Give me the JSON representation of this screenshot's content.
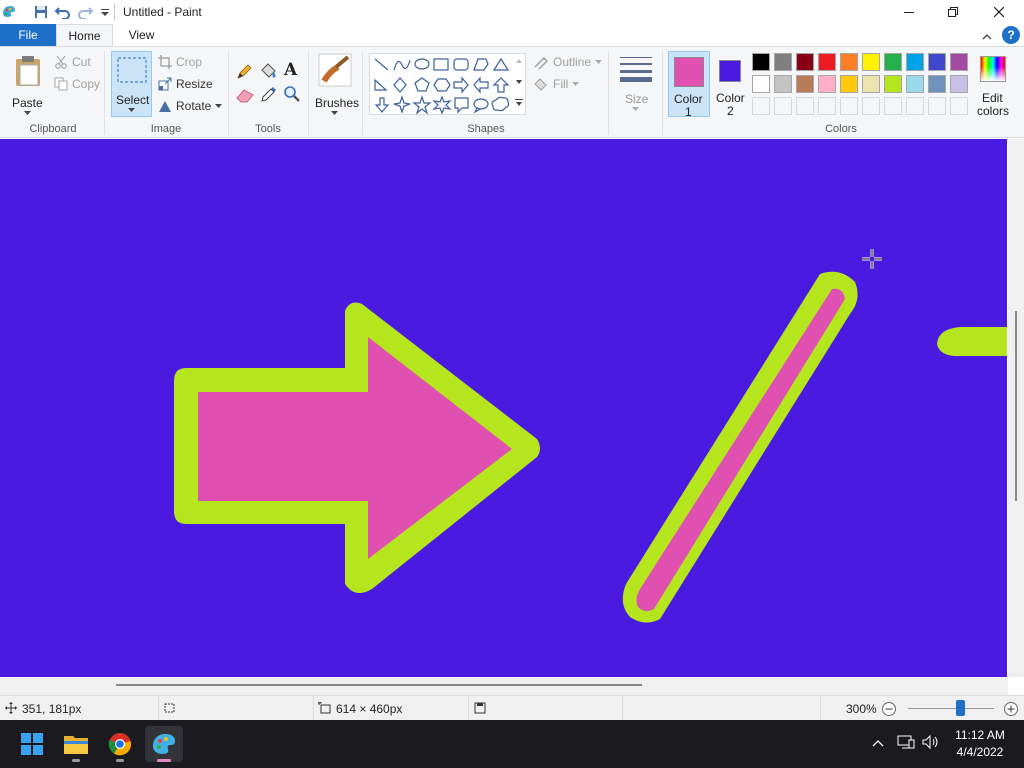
{
  "titlebar": {
    "title": "Untitled - Paint",
    "quick_access": [
      "app-icon",
      "save-icon",
      "undo-icon",
      "redo-icon",
      "customize-icon"
    ]
  },
  "tabs": {
    "file": "File",
    "home": "Home",
    "view": "View"
  },
  "ribbon": {
    "clipboard": {
      "paste": "Paste",
      "cut": "Cut",
      "copy": "Copy",
      "group": "Clipboard"
    },
    "image": {
      "select": "Select",
      "crop": "Crop",
      "resize": "Resize",
      "rotate": "Rotate",
      "group": "Image"
    },
    "tools": {
      "group": "Tools",
      "items": [
        "pencil-icon",
        "fill-icon",
        "text-icon",
        "eraser-icon",
        "color-picker-icon",
        "magnifier-icon"
      ]
    },
    "brushes": {
      "label": "Brushes"
    },
    "shapes": {
      "outline": "Outline",
      "fill": "Fill",
      "group": "Shapes"
    },
    "size": {
      "label": "Size"
    },
    "colors": {
      "color1_label": "Color\n1",
      "color1_line1": "Color",
      "color1_line2": "1",
      "color2_line1": "Color",
      "color2_line2": "2",
      "color1": "#e050b0",
      "color2": "#4a1ae0",
      "edit_line1": "Edit",
      "edit_line2": "colors",
      "group": "Colors",
      "palette_row1": [
        "#000000",
        "#7f7f7f",
        "#880015",
        "#ed1c24",
        "#ff7f27",
        "#fff200",
        "#22b14c",
        "#00a2e8",
        "#3f48cc",
        "#a349a4"
      ],
      "palette_row2": [
        "#ffffff",
        "#c3c3c3",
        "#b97a57",
        "#ffaec9",
        "#ffc90e",
        "#efe4b0",
        "#b5e61d",
        "#99d9ea",
        "#7092be",
        "#c8bfe7"
      ]
    }
  },
  "canvas": {
    "background": "#4a1ae0",
    "outline_color": "#b5e61d",
    "fill_color": "#e050b0"
  },
  "statusbar": {
    "cursor_pos": "351, 181px",
    "canvas_size": "614 × 460px",
    "zoom": "300%"
  },
  "taskbar": {
    "time": "11:12 AM",
    "date": "4/4/2022",
    "apps": [
      "start-icon",
      "file-explorer-icon",
      "chrome-icon",
      "paint-icon"
    ]
  }
}
